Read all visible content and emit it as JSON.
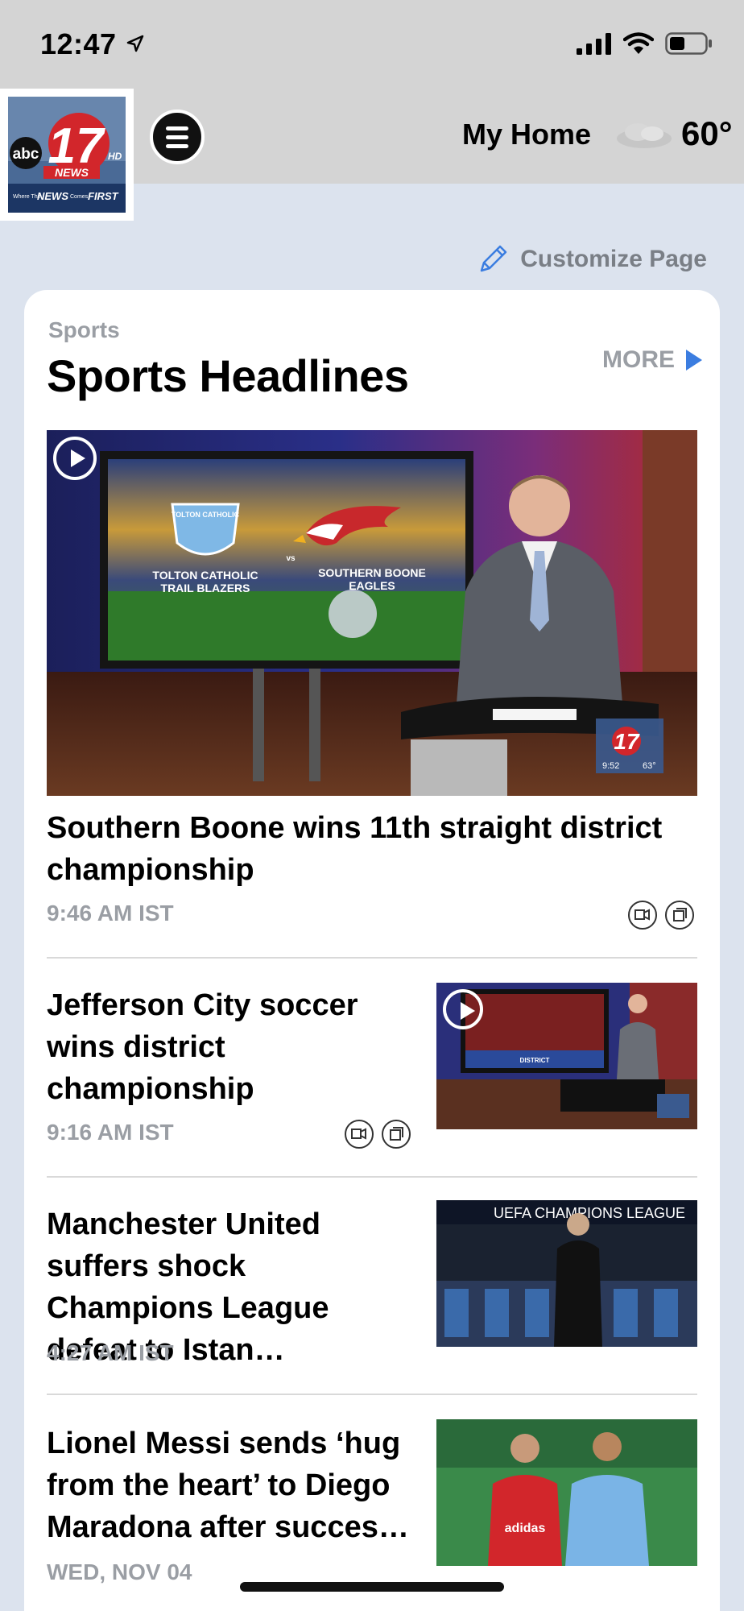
{
  "status_bar": {
    "time": "12:47"
  },
  "header": {
    "logo": {
      "network": "abc",
      "channel": "17",
      "hd": "HD",
      "news": "NEWS",
      "tagline_small": "Where The",
      "tagline_news": "NEWS",
      "tagline_comes": "Comes",
      "tagline_first": "FIRST"
    },
    "location": "My Home",
    "temperature": "60°"
  },
  "customize_label": "Customize Page",
  "section": {
    "category": "Sports",
    "title": "Sports Headlines",
    "more_label": "MORE"
  },
  "hero": {
    "teams": {
      "left_badge": "TOLTON CATHOLIC",
      "left_name_1": "TOLTON CATHOLIC",
      "left_name_2": "TRAIL BLAZERS",
      "vs": "vs",
      "right_name_1": "SOUTHERN BOONE",
      "right_name_2": "EAGLES"
    },
    "bug": {
      "time": "9:52",
      "temp": "63°"
    },
    "headline": "Southern Boone wins 11th straight district championship",
    "timestamp": "9:46 AM IST"
  },
  "stories": [
    {
      "headline": "Jefferson City soccer wins district championship",
      "timestamp": "9:16 AM IST",
      "thumb_caption": "DISTRICT"
    },
    {
      "headline": "Manchester United suffers shock Champions League defeat to Istan…",
      "timestamp": "4:27 AM IST",
      "thumb_caption": "UEFA CHAMPIONS LEAGUE"
    },
    {
      "headline": "Lionel Messi sends ‘hug from the heart’ to Diego Maradona after succes…",
      "timestamp": "WED, NOV 04",
      "thumb_caption": "adidas"
    }
  ],
  "colors": {
    "accent": "#3b7de0",
    "header_bg": "#d4d4d4",
    "page_bg": "#dce3ee"
  }
}
